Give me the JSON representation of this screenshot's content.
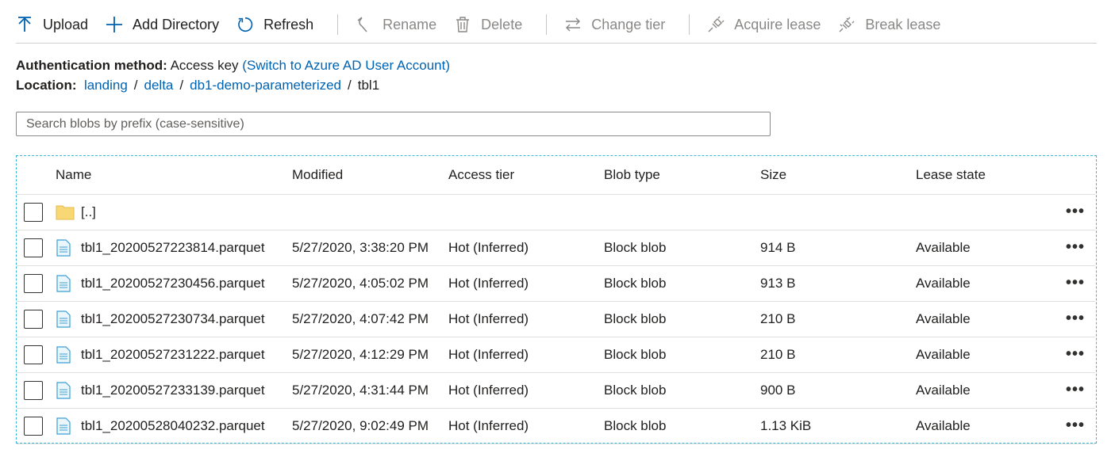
{
  "toolbar": {
    "upload": "Upload",
    "add_directory": "Add Directory",
    "refresh": "Refresh",
    "rename": "Rename",
    "delete": "Delete",
    "change_tier": "Change tier",
    "acquire_lease": "Acquire lease",
    "break_lease": "Break lease"
  },
  "auth": {
    "label": "Authentication method:",
    "value": "Access key",
    "switch_link": "(Switch to Azure AD User Account)"
  },
  "location": {
    "label": "Location:",
    "crumbs": [
      "landing",
      "delta",
      "db1-demo-parameterized"
    ],
    "current": "tbl1",
    "separator": "/"
  },
  "search": {
    "placeholder": "Search blobs by prefix (case-sensitive)"
  },
  "table": {
    "headers": {
      "name": "Name",
      "modified": "Modified",
      "tier": "Access tier",
      "type": "Blob type",
      "size": "Size",
      "lease": "Lease state"
    },
    "parent_row": {
      "name": "[..]"
    },
    "more_label": "•••",
    "rows": [
      {
        "name": "tbl1_20200527223814.parquet",
        "modified": "5/27/2020, 3:38:20 PM",
        "tier": "Hot (Inferred)",
        "type": "Block blob",
        "size": "914 B",
        "lease": "Available"
      },
      {
        "name": "tbl1_20200527230456.parquet",
        "modified": "5/27/2020, 4:05:02 PM",
        "tier": "Hot (Inferred)",
        "type": "Block blob",
        "size": "913 B",
        "lease": "Available"
      },
      {
        "name": "tbl1_20200527230734.parquet",
        "modified": "5/27/2020, 4:07:42 PM",
        "tier": "Hot (Inferred)",
        "type": "Block blob",
        "size": "210 B",
        "lease": "Available"
      },
      {
        "name": "tbl1_20200527231222.parquet",
        "modified": "5/27/2020, 4:12:29 PM",
        "tier": "Hot (Inferred)",
        "type": "Block blob",
        "size": "210 B",
        "lease": "Available"
      },
      {
        "name": "tbl1_20200527233139.parquet",
        "modified": "5/27/2020, 4:31:44 PM",
        "tier": "Hot (Inferred)",
        "type": "Block blob",
        "size": "900 B",
        "lease": "Available"
      },
      {
        "name": "tbl1_20200528040232.parquet",
        "modified": "5/27/2020, 9:02:49 PM",
        "tier": "Hot (Inferred)",
        "type": "Block blob",
        "size": "1.13 KiB",
        "lease": "Available"
      }
    ]
  },
  "colors": {
    "accent": "#0063b1",
    "disabled": "#8a8886",
    "focus_border": "#3bb8d6",
    "folder": "#f8d775"
  }
}
